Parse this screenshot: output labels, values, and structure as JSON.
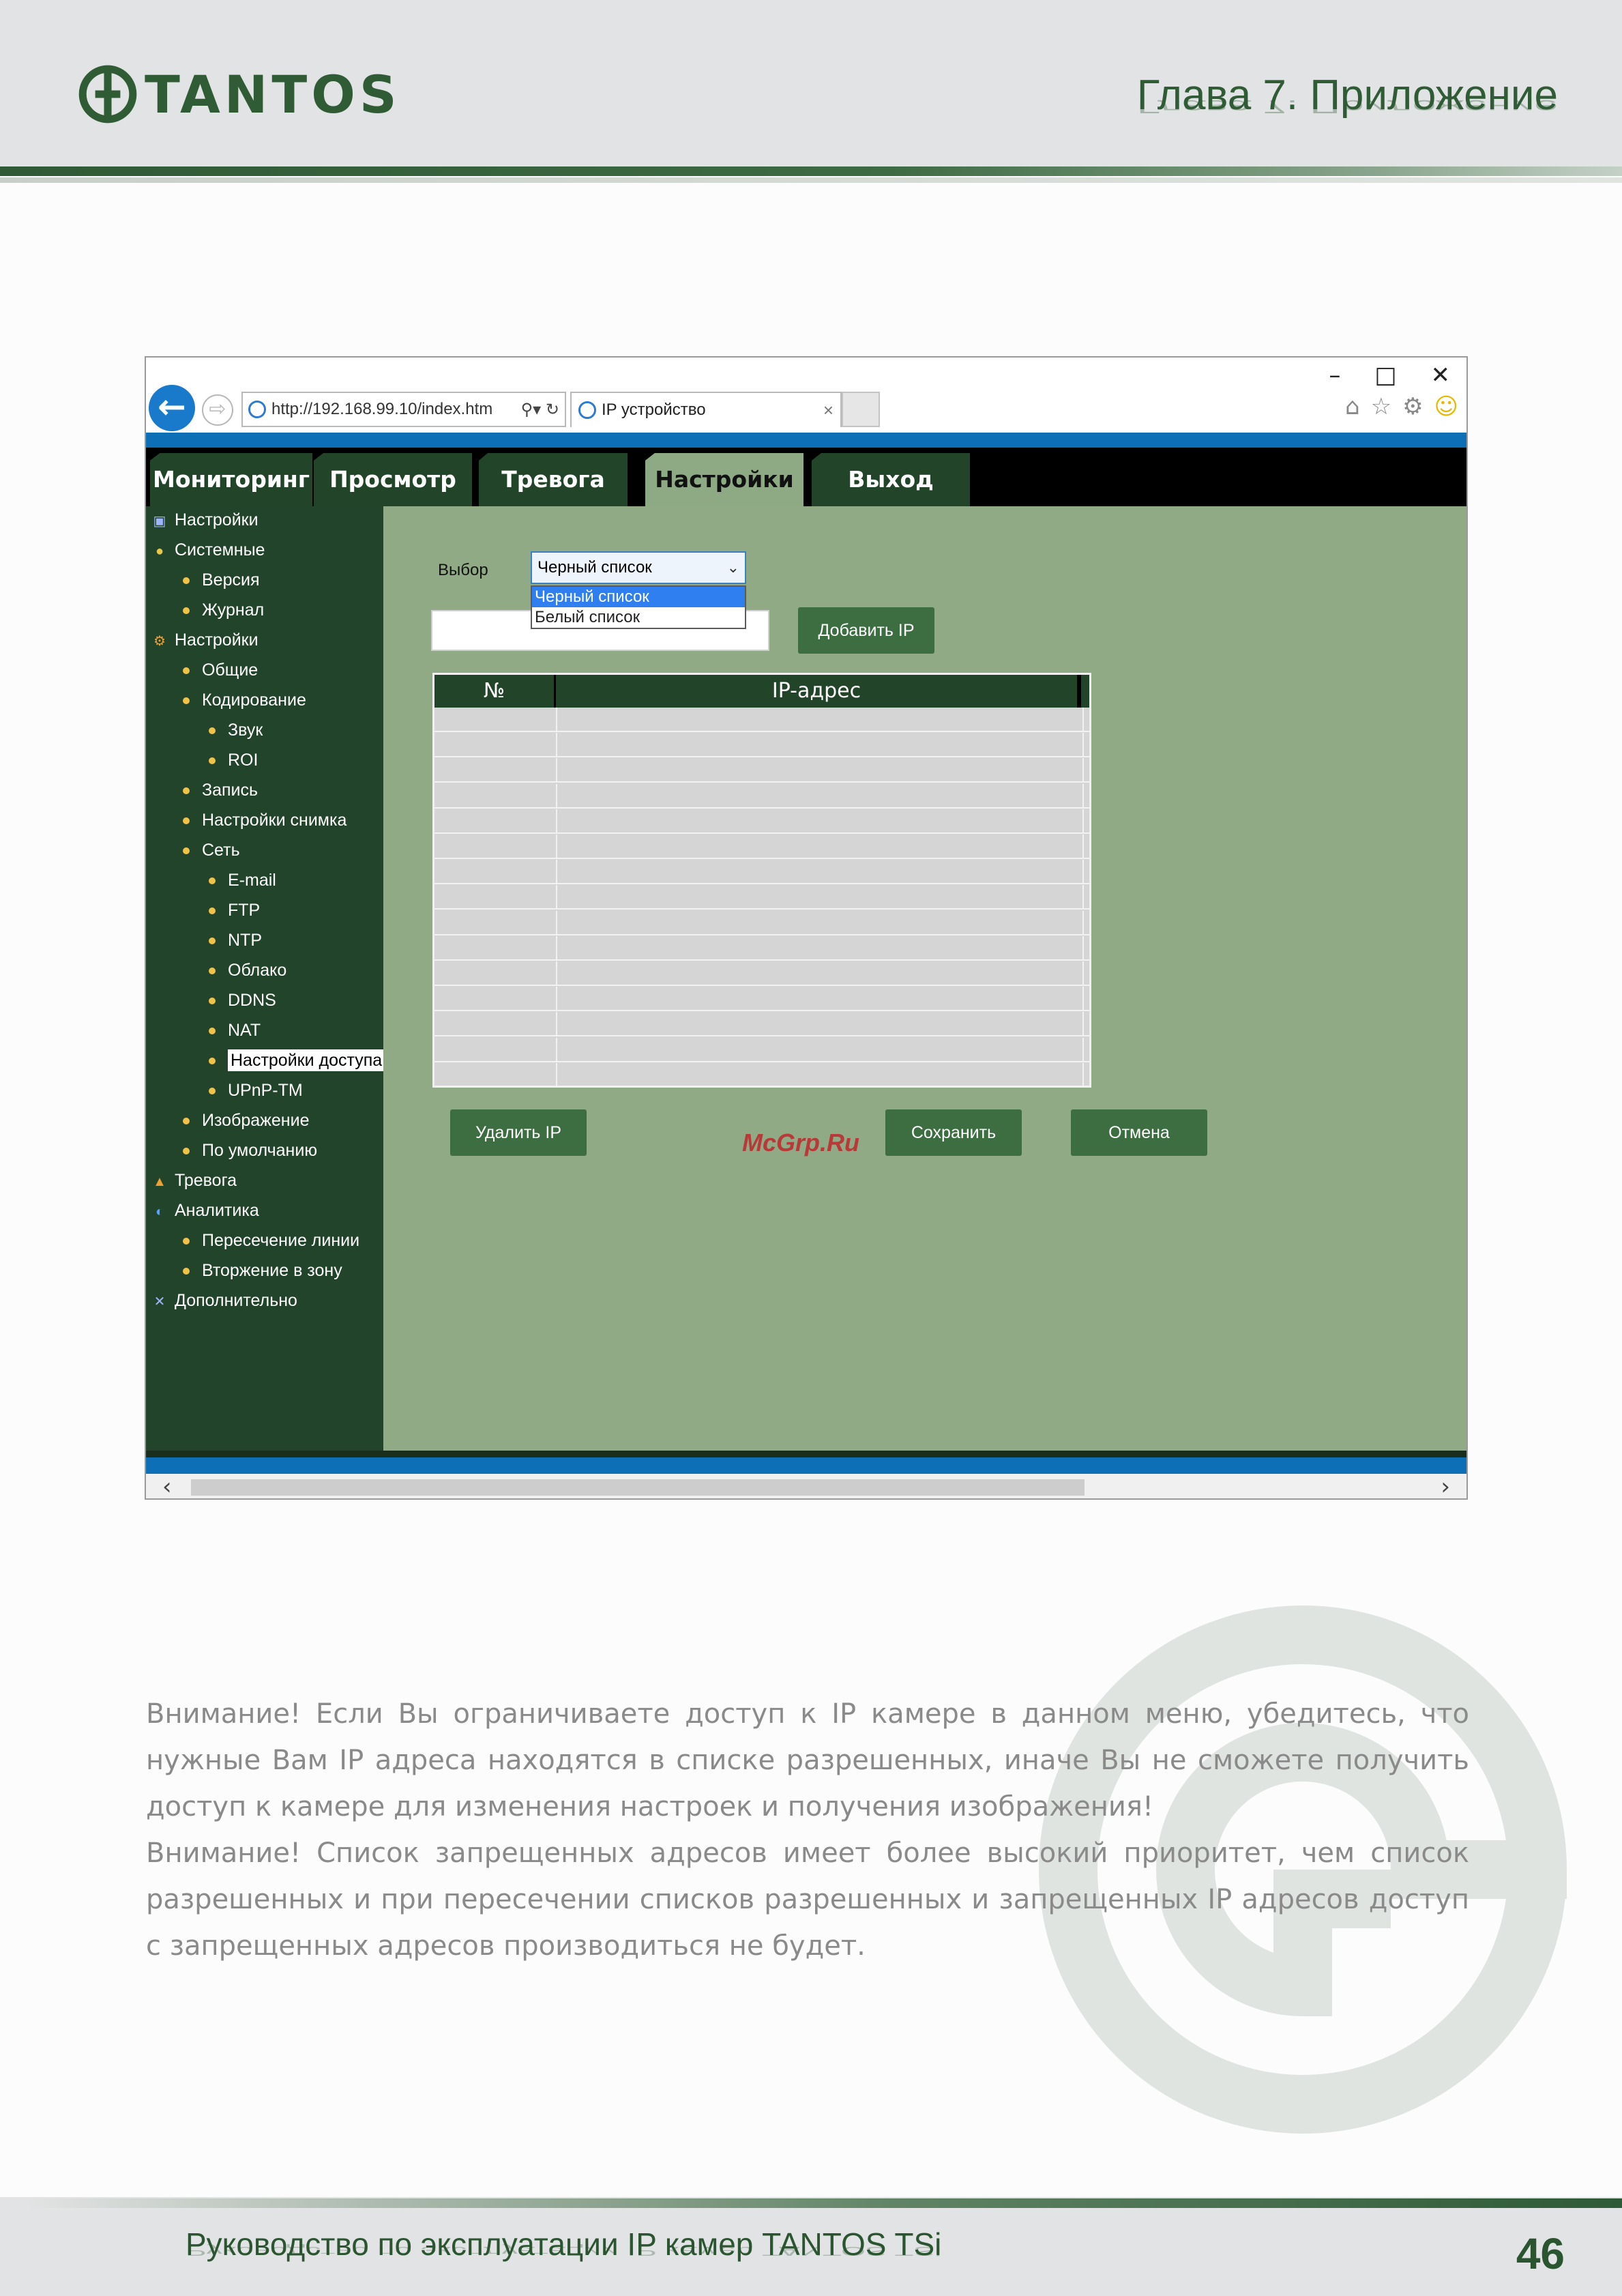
{
  "header": {
    "logo_text": "TANTOS",
    "chapter": "Глава 7. Приложение"
  },
  "browser": {
    "url": "http://192.168.99.10/index.htm",
    "tab_title": "IP устройство",
    "nav": [
      "Мониторинг",
      "Просмотр",
      "Тревога",
      "Настройки",
      "Выход"
    ],
    "active_nav": "Настройки"
  },
  "sidebar": {
    "items": [
      {
        "label": "Настройки",
        "level": 0,
        "icon": "settings-icon"
      },
      {
        "label": "Системные",
        "level": 0,
        "icon": "info-icon"
      },
      {
        "label": "Версия",
        "level": 1
      },
      {
        "label": "Журнал",
        "level": 1
      },
      {
        "label": "Настройки",
        "level": 0,
        "icon": "gear-icon"
      },
      {
        "label": "Общие",
        "level": 1
      },
      {
        "label": "Кодирование",
        "level": 1
      },
      {
        "label": "Звук",
        "level": 2
      },
      {
        "label": "ROI",
        "level": 2
      },
      {
        "label": "Запись",
        "level": 1
      },
      {
        "label": "Настройки снимка",
        "level": 1
      },
      {
        "label": "Сеть",
        "level": 1
      },
      {
        "label": "E-mail",
        "level": 2
      },
      {
        "label": "FTP",
        "level": 2
      },
      {
        "label": "NTP",
        "level": 2
      },
      {
        "label": "Облако",
        "level": 2
      },
      {
        "label": "DDNS",
        "level": 2
      },
      {
        "label": "NAT",
        "level": 2
      },
      {
        "label": "Настройки доступа",
        "level": 2,
        "selected": true
      },
      {
        "label": "UPnP-TM",
        "level": 2
      },
      {
        "label": "Изображение",
        "level": 1
      },
      {
        "label": "По умолчанию",
        "level": 1
      },
      {
        "label": "Тревога",
        "level": 0,
        "icon": "bell-icon"
      },
      {
        "label": "Аналитика",
        "level": 0,
        "icon": "analytics-icon"
      },
      {
        "label": "Пересечение линии",
        "level": 1
      },
      {
        "label": "Вторжение в зону",
        "level": 1
      },
      {
        "label": "Дополнительно",
        "level": 0,
        "icon": "tools-icon"
      }
    ]
  },
  "form": {
    "select_label": "Выбор",
    "select_value": "Черный список",
    "options": [
      "Черный список",
      "Белый список"
    ],
    "add_button": "Добавить IP",
    "table_headers": [
      "№",
      "IP-адрес"
    ],
    "row_count": 15,
    "delete_button": "Удалить IP",
    "save_button": "Сохранить",
    "cancel_button": "Отмена",
    "stamp": "McGrp.Ru"
  },
  "warnings": [
    "Внимание! Если Вы ограничиваете доступ к IP камере в данном меню, убедитесь, что нужные Вам IP адреса находятся в списке разрешенных, иначе Вы не сможете получить доступ к камере для изменения настроек и получения изображения!",
    "Внимание! Список запрещенных адресов имеет более высокий приоритет, чем список разрешенных и при пересечении списков разрешенных и запрещенных IP адресов доступ с запрещенных адресов производиться не будет."
  ],
  "footer": {
    "title": "Руководство по эксплуатации IP камер TANTOS TSi",
    "page": "46"
  },
  "colors": {
    "brand_green": "#2f5b35",
    "panel_green": "#90aa85",
    "sidebar_green": "#22442a",
    "browser_blue": "#0d6fb6"
  }
}
